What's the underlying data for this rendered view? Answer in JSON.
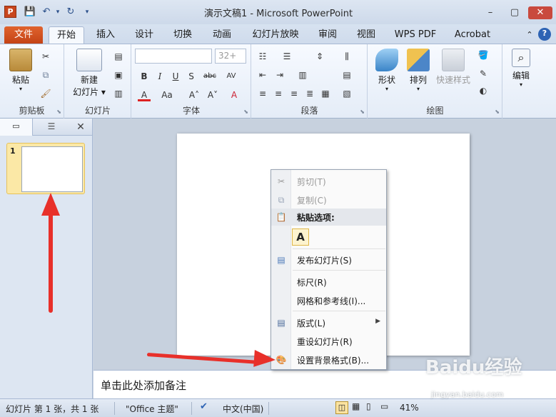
{
  "window": {
    "title": "演示文稿1 - Microsoft PowerPoint",
    "app_icon_letter": "P",
    "controls": {
      "minimize": "–",
      "maximize": "▢",
      "close": "✕"
    }
  },
  "quick_access": {
    "save": "💾",
    "undo": "↶",
    "undo_drop": "▾",
    "redo": "↻",
    "customize": "▾"
  },
  "tabs": [
    {
      "label": "文件"
    },
    {
      "label": "开始"
    },
    {
      "label": "插入"
    },
    {
      "label": "设计"
    },
    {
      "label": "切换"
    },
    {
      "label": "动画"
    },
    {
      "label": "幻灯片放映"
    },
    {
      "label": "审阅"
    },
    {
      "label": "视图"
    },
    {
      "label": "WPS PDF"
    },
    {
      "label": "Acrobat"
    }
  ],
  "ribbon_right": {
    "collapse": "⌃",
    "help": "?"
  },
  "ribbon": {
    "clipboard": {
      "label": "剪贴板",
      "paste": "粘贴"
    },
    "slides": {
      "label": "幻灯片",
      "new_slide_1": "新建",
      "new_slide_2": "幻灯片 ▾"
    },
    "font": {
      "label": "字体",
      "size": "32+",
      "bold": "B",
      "italic": "I",
      "underline": "U",
      "strike": "S",
      "spacing": "abc",
      "av": "AV",
      "fontcolor": "A",
      "case": "Aa",
      "grow": "A˄",
      "shrink": "A˅",
      "clear": "A"
    },
    "paragraph": {
      "label": "段落"
    },
    "drawing": {
      "label": "绘图",
      "shapes": "形状",
      "arrange": "排列",
      "quick_styles": "快速样式"
    },
    "editing": {
      "label": "编辑"
    }
  },
  "pane_tabs": {
    "slides_tab": "▭",
    "outline_tab": "☰",
    "close": "✕"
  },
  "slide_thumb": {
    "number": "1"
  },
  "notes": {
    "placeholder": "单击此处添加备注"
  },
  "context_menu": {
    "cut": "剪切(T)",
    "copy": "复制(C)",
    "paste_header": "粘贴选项:",
    "paste_keep": "A",
    "publish": "发布幻灯片(S)",
    "ruler": "标尺(R)",
    "grid": "网格和参考线(I)...",
    "layout": "版式(L)",
    "reset": "重设幻灯片(R)",
    "bg_format": "设置背景格式(B)..."
  },
  "status": {
    "slide": "幻灯片 第 1 张，共 1 张",
    "theme": "\"Office 主题\"",
    "language": "中文(中国)",
    "zoom": "41%"
  },
  "watermark": {
    "text": "Baidu经验",
    "url": "jingyan.baidu.com"
  },
  "colors": {
    "file_tab": "#d0501f",
    "annotation_arrow": "#e8302a",
    "ribbon_bg": "#e4ecf7"
  }
}
